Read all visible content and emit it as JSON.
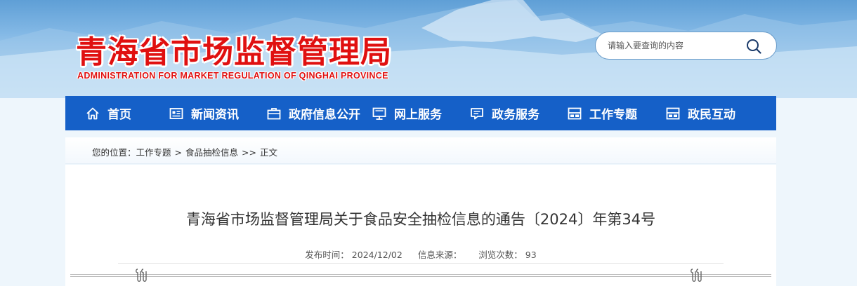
{
  "header": {
    "title": "青海省市场监督管理局",
    "subtitle": "ADMINISTRATION FOR MARKET REGULATION OF QINGHAI PROVINCE",
    "search": {
      "placeholder": "请输入要查询的内容",
      "icon": "search-icon"
    }
  },
  "nav": {
    "items": [
      {
        "label": "首页",
        "icon": "home-icon"
      },
      {
        "label": "新闻资讯",
        "icon": "news-icon"
      },
      {
        "label": "政府信息公开",
        "icon": "briefcase-icon"
      },
      {
        "label": "网上服务",
        "icon": "monitor-icon"
      },
      {
        "label": "政务服务",
        "icon": "chat-icon"
      },
      {
        "label": "工作专题",
        "icon": "layout-icon"
      },
      {
        "label": "政民互动",
        "icon": "layout-icon"
      }
    ]
  },
  "breadcrumb": {
    "prefix": "您的位置：",
    "items": [
      "工作专题",
      "食品抽检信息",
      "正文"
    ],
    "sep1": ">",
    "sep2": ">>"
  },
  "article": {
    "title": "青海省市场监督管理局关于食品安全抽检信息的通告〔2024〕年第34号",
    "meta": {
      "date_label": "发布时间：",
      "date": "2024/12/02",
      "source_label": "信息来源：",
      "views_label": "浏览次数：",
      "views": "93"
    }
  },
  "colors": {
    "nav_bg": "#1560c8",
    "title_red": "#e01010"
  }
}
